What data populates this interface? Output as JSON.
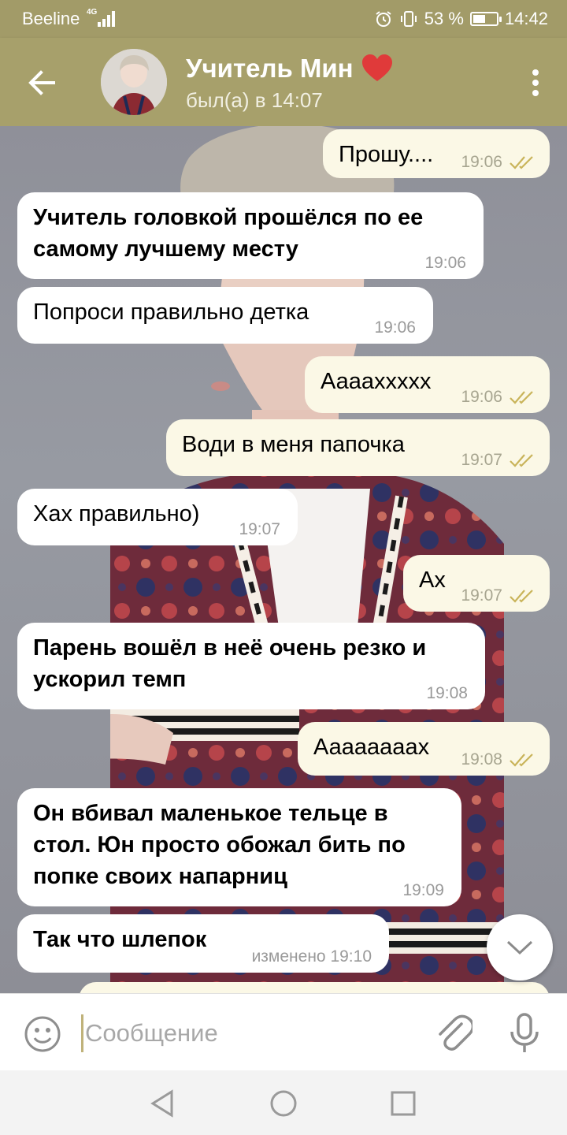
{
  "status_bar": {
    "carrier": "Beeline",
    "network": "4G",
    "battery": "53 %",
    "battery_level": 0.53,
    "time": "14:42"
  },
  "header": {
    "contact_name": "Учитель Мин",
    "contact_emoji": "❤",
    "last_seen": "был(а) в 14:07",
    "icons": {
      "back": "arrow-left-icon",
      "menu": "more-vertical-icon"
    }
  },
  "messages": [
    {
      "dir": "out",
      "text": "Прошу....",
      "time": "19:06",
      "bold": false
    },
    {
      "dir": "in",
      "text": "Учитель головкой прошёлся по ее самому лучшему месту",
      "time": "19:06",
      "bold": true
    },
    {
      "dir": "in",
      "text": "Попроси правильно детка",
      "time": "19:06",
      "bold": false
    },
    {
      "dir": "out",
      "text": "Аааахxxxx",
      "time": "19:06",
      "bold": false
    },
    {
      "dir": "out",
      "text": "Води в меня папочка",
      "time": "19:07",
      "bold": false
    },
    {
      "dir": "in",
      "text": "Хах правильно)",
      "time": "19:07",
      "bold": false
    },
    {
      "dir": "out",
      "text": "Ах",
      "time": "19:07",
      "bold": false
    },
    {
      "dir": "in",
      "text": "Парень вошёл в неё очень резко и ускорил темп",
      "time": "19:08",
      "bold": true
    },
    {
      "dir": "out",
      "text": "Аааааааах",
      "time": "19:08",
      "bold": false
    },
    {
      "dir": "in",
      "text": "Он вбивал маленькое тельце в стол. Юн просто обожал бить по попке своих напарниц",
      "time": "19:09",
      "bold": true
    },
    {
      "dir": "in",
      "text": "Так что шлепок",
      "time": "изменено 19:10",
      "bold": true
    }
  ],
  "input": {
    "placeholder": "Сообщение",
    "value": ""
  },
  "colors": {
    "header": "#a7a06b",
    "status_bar": "#a29b68",
    "outgoing_bubble": "#fbf8e6",
    "incoming_bubble": "#ffffff",
    "read_ticks": "#c9b45a"
  },
  "icons": [
    "emoji-icon",
    "attach-icon",
    "mic-icon",
    "scroll-down-icon",
    "nav-back-icon",
    "nav-home-icon",
    "nav-recents-icon"
  ]
}
